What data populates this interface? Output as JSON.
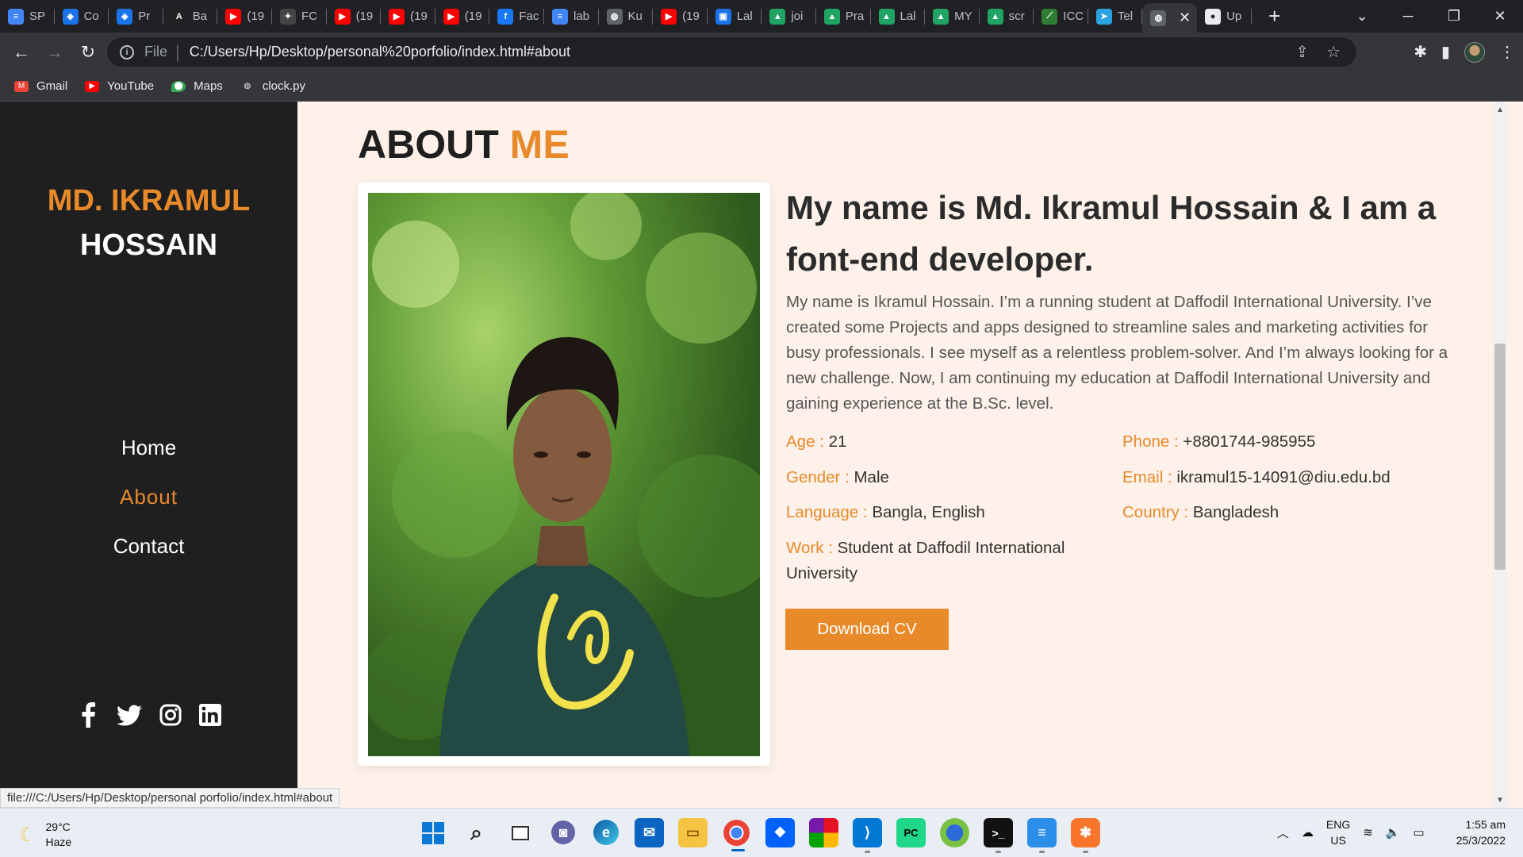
{
  "browser": {
    "tabs": [
      {
        "title": "SP",
        "icon": "docs-icon",
        "color": "#4285f4"
      },
      {
        "title": "Co",
        "icon": "codeforces-icon",
        "color": "#1a73e8"
      },
      {
        "title": "Pr",
        "icon": "codeforces-icon",
        "color": "#1a73e8"
      },
      {
        "title": "Ba",
        "icon": "atcoder-icon",
        "color": "#222"
      },
      {
        "title": "(19",
        "icon": "youtube-icon",
        "color": "#ff0000"
      },
      {
        "title": "FC",
        "icon": "chatgpt-icon",
        "color": "#444"
      },
      {
        "title": "(19",
        "icon": "youtube-icon",
        "color": "#ff0000"
      },
      {
        "title": "(19",
        "icon": "youtube-icon",
        "color": "#ff0000"
      },
      {
        "title": "(19",
        "icon": "youtube-icon",
        "color": "#ff0000"
      },
      {
        "title": "Fac",
        "icon": "facebook-icon",
        "color": "#1877f2"
      },
      {
        "title": "lab",
        "icon": "docs-icon",
        "color": "#4285f4"
      },
      {
        "title": "Ku",
        "icon": "globe-icon",
        "color": "#5f6368"
      },
      {
        "title": "(19",
        "icon": "youtube-icon",
        "color": "#ff0000"
      },
      {
        "title": "Lal",
        "icon": "contacts-icon",
        "color": "#1a73e8"
      },
      {
        "title": "joi",
        "icon": "drive-icon",
        "color": "#1fa463"
      },
      {
        "title": "Pra",
        "icon": "drive-icon",
        "color": "#1fa463"
      },
      {
        "title": "Lal",
        "icon": "drive-icon",
        "color": "#1fa463"
      },
      {
        "title": "MY",
        "icon": "drive-icon",
        "color": "#1fa463"
      },
      {
        "title": "scr",
        "icon": "drive-icon",
        "color": "#1fa463"
      },
      {
        "title": "ICC",
        "icon": "icc-icon",
        "color": "#2e7d32"
      },
      {
        "title": "Tel",
        "icon": "telegram-icon",
        "color": "#2aa3e0"
      },
      {
        "title": "",
        "icon": "globe-icon",
        "color": "#5f6368",
        "active": true
      },
      {
        "title": "Up",
        "icon": "github-icon",
        "color": "#e8eaed"
      }
    ],
    "file_label": "File",
    "url": "C:/Users/Hp/Desktop/personal%20porfolio/index.html#about",
    "bookmarks": [
      {
        "label": "Gmail",
        "icon": "gmail-icon"
      },
      {
        "label": "YouTube",
        "icon": "youtube-icon"
      },
      {
        "label": "Maps",
        "icon": "maps-icon"
      },
      {
        "label": "clock.py",
        "icon": "globe-icon"
      }
    ],
    "status_link": "file:///C:/Users/Hp/Desktop/personal porfolio/index.html#about"
  },
  "sidebar": {
    "brand_first": "MD. IKRAMUL",
    "brand_last": "HOSSAIN",
    "nav": [
      "Home",
      "About",
      "Contact"
    ],
    "active_nav": "About",
    "social_icons": [
      "facebook-icon",
      "twitter-icon",
      "instagram-icon",
      "linkedin-icon"
    ]
  },
  "about": {
    "title_main": "ABOUT",
    "title_accent": "ME",
    "heading": "My name is Md. Ikramul Hossain & I am a font-end developer.",
    "bio": "My name is Ikramul Hossain. I’m a running student at Daffodil International University. I’ve created some Projects and apps designed to streamline sales and marketing activities for busy professionals. I see myself as a relentless problem-solver. And I’m always looking for a new challenge. Now, I am continuing my education at Daffodil International University and gaining experience at the B.Sc. level.",
    "info": {
      "age_label": "Age :",
      "age": "21",
      "phone_label": "Phone :",
      "phone": "+8801744-985955",
      "gender_label": "Gender :",
      "gender": "Male",
      "email_label": "Email :",
      "email": "ikramul15-14091@diu.edu.bd",
      "language_label": "Language :",
      "language": "Bangla, English",
      "country_label": "Country :",
      "country": "Bangladesh",
      "work_label": "Work :",
      "work": "Student at Daffodil International University"
    },
    "cv_button": "Download CV",
    "accent_color": "#e88a2a"
  },
  "taskbar": {
    "temperature": "29°C",
    "weather": "Haze",
    "lang_top": "ENG",
    "lang_bottom": "US",
    "time": "1:55 am",
    "date": "25/3/2022"
  }
}
